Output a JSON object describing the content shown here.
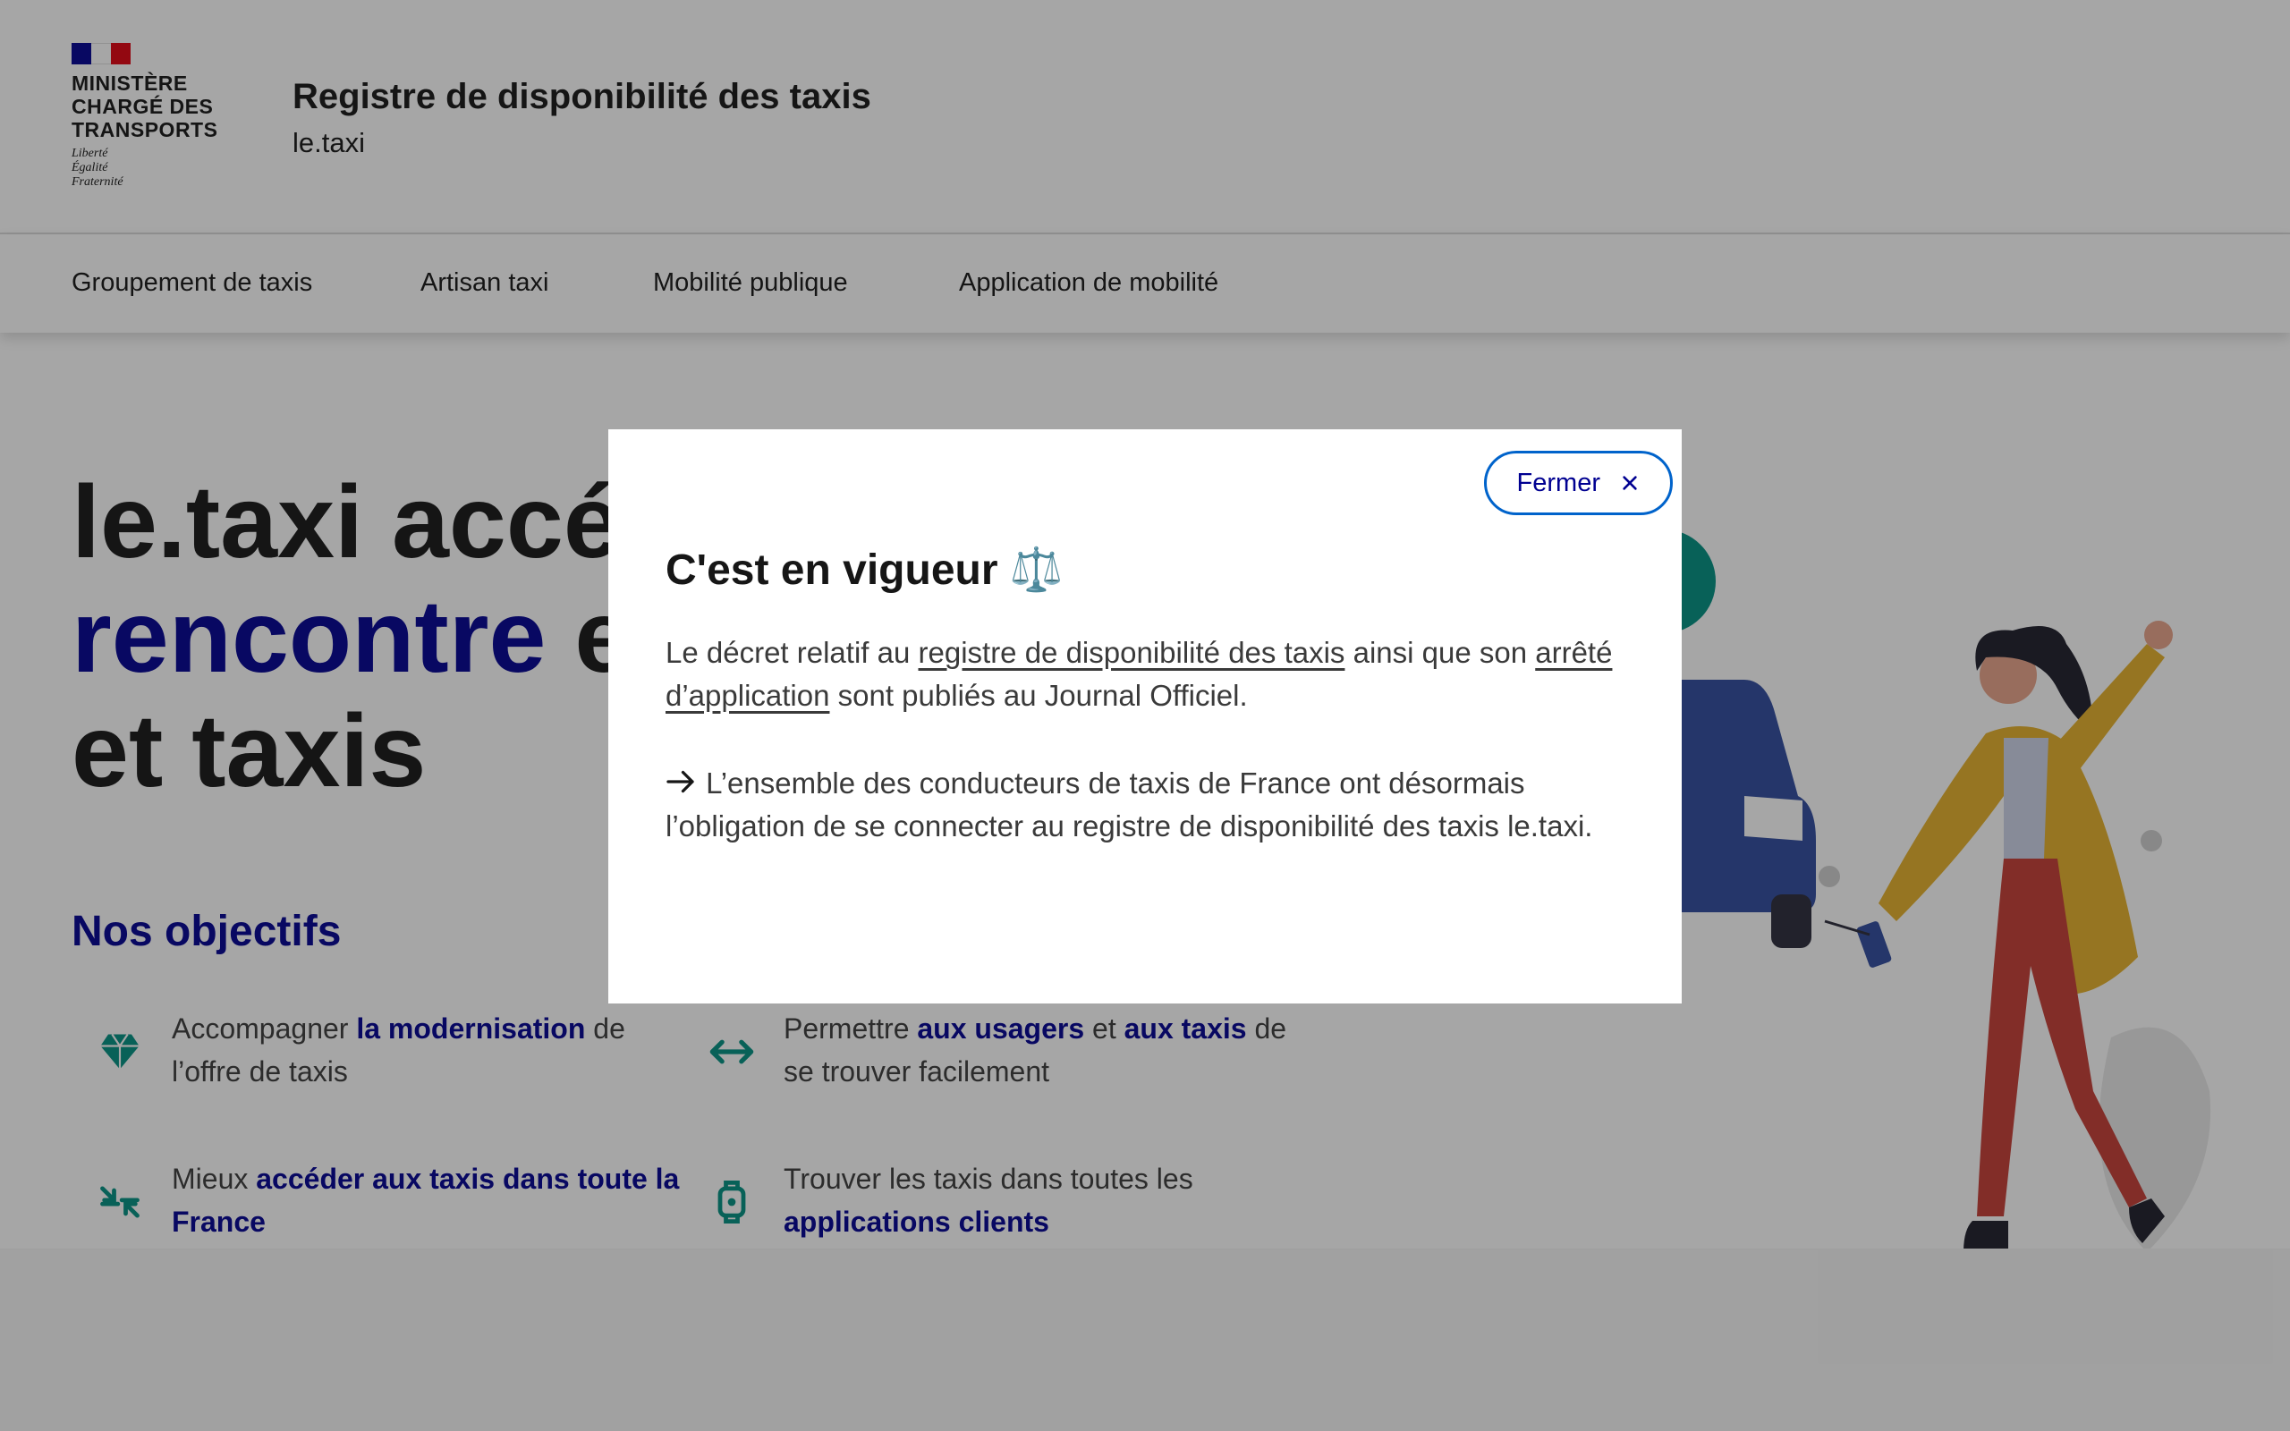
{
  "header": {
    "logo": {
      "title_lines": [
        "MINISTÈRE",
        "CHARGÉ DES",
        "TRANSPORTS"
      ],
      "motto_lines": [
        "Liberté",
        "Égalité",
        "Fraternité"
      ]
    },
    "service_title": "Registre de disponibilité des taxis",
    "service_tagline": "le.taxi"
  },
  "nav": {
    "items": [
      {
        "label": "Groupement de taxis"
      },
      {
        "label": "Artisan taxi"
      },
      {
        "label": "Mobilité publique"
      },
      {
        "label": "Application de mobilité"
      }
    ]
  },
  "hero": {
    "line1": "le.taxi accé",
    "line2_blue": "rencontre",
    "line2_rest": " e",
    "line3": "et taxis"
  },
  "objectives": {
    "title": "Nos objectifs",
    "items": [
      {
        "icon": "gem-icon",
        "pre": "Accompagner ",
        "strong": "la modernisation",
        "post": " de l’offre de taxis"
      },
      {
        "icon": "arrows-left-right-icon",
        "pre": "Permettre ",
        "strong": "aux usagers",
        "mid": " et ",
        "strong2": "aux taxis",
        "post": " de se trouver facilement"
      },
      {
        "icon": "arrows-collapse-icon",
        "pre": "Mieux ",
        "strong": "accéder aux taxis dans toute la France",
        "post": ""
      },
      {
        "icon": "smartwatch-icon",
        "pre": "Trouver les taxis dans toutes les ",
        "strong": "applications clients",
        "post": ""
      }
    ]
  },
  "modal": {
    "close_label": "Fermer",
    "close_icon": "close-icon",
    "title": "C'est en vigueur",
    "title_emoji": "⚖️",
    "p1_pre": "Le décret relatif au ",
    "p1_link1": "registre de disponibilité des taxis",
    "p1_mid": " ainsi que son ",
    "p1_link2": "arrêté d’application",
    "p1_post": " sont publiés au Journal Officiel.",
    "p2_icon": "arrow-right-icon",
    "p2": " L’ensemble des conducteurs de taxis de France ont désormais l’obligation de se connecter au registre de disponibilité des taxis le.taxi."
  },
  "colors": {
    "blue_france": "#000091",
    "red_marianne": "#e1000f",
    "accent_teal": "#009081",
    "focus_blue": "#0063cb"
  }
}
